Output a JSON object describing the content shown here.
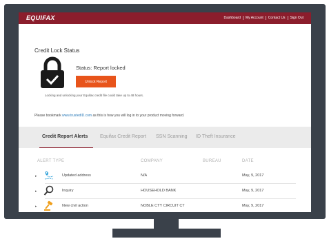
{
  "header": {
    "logo": "EQUIFAX",
    "nav": [
      "Dashboard",
      "My Account",
      "Contact Us",
      "Sign Out"
    ]
  },
  "lock": {
    "title": "Credit Lock Status",
    "status": "Status: Report locked",
    "unlock_label": "Unlock Report",
    "note": "Locking and unlocking your Equifax credit file could take up to 48 hours."
  },
  "bookmark": {
    "prefix": "Please bookmark ",
    "link": "www.trustedID.com",
    "suffix": " as this is how you will log in to your product moving forward."
  },
  "tabs": [
    "Credit Report Alerts",
    "Equifax Credit Report",
    "SSN Scanning",
    "ID Theft Insurance"
  ],
  "table": {
    "columns": [
      "ALERT TYPE",
      "COMPANY",
      "BUREAU",
      "DATE"
    ],
    "rows": [
      {
        "icon": "address-icon",
        "type": "Updated address",
        "company": "N/A",
        "bureau": "",
        "date": "May, 9, 2017"
      },
      {
        "icon": "magnifier-icon",
        "type": "Inquiry",
        "company": "HOUSEHOLD BANK",
        "bureau": "",
        "date": "May, 9, 2017"
      },
      {
        "icon": "gavel-icon",
        "type": "New civil action",
        "company": "NOBLE CTY CIRCUIT CT",
        "bureau": "",
        "date": "May, 9, 2017"
      }
    ]
  },
  "colors": {
    "brand": "#8b1d2c",
    "button": "#e8541b",
    "bezel": "#3a414a",
    "link": "#2a7ab8"
  }
}
